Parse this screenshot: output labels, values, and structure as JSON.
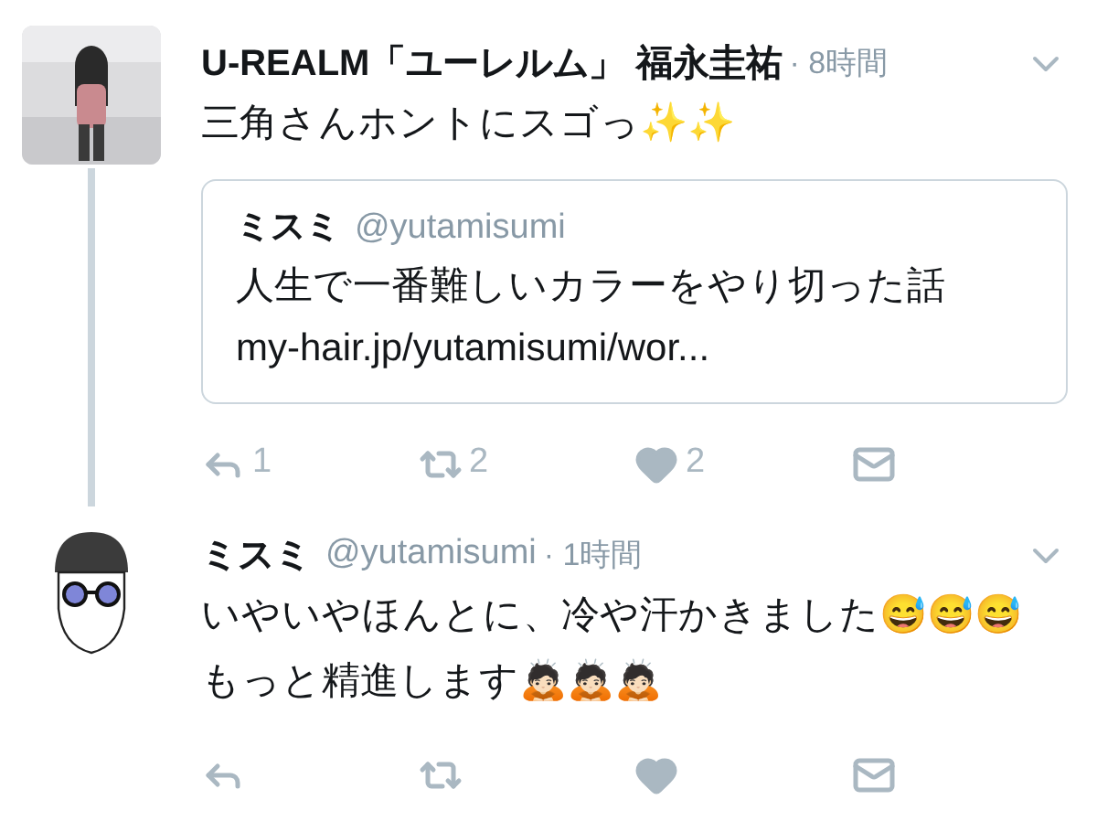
{
  "tweets": [
    {
      "name": "U-REALM「ユーレルム」 福永圭祐",
      "time": "· 8時間",
      "lines": [
        "三角さんホントにスゴっ✨✨"
      ],
      "quote": {
        "name": "ミスミ",
        "handle": "@yutamisumi",
        "lines": [
          "人生で一番難しいカラーをやり切った話",
          "my-hair.jp/yutamisumi/wor..."
        ]
      },
      "actions": {
        "replies": "1",
        "retweets": "2",
        "likes": "2"
      },
      "thread_line": true
    },
    {
      "name": "ミスミ",
      "handle": "@yutamisumi",
      "time": "· 1時間",
      "lines": [
        "いやいやほんとに、冷や汗かきました😅😅😅",
        "もっと精進します🙇🏻🙇🏻🙇🏻"
      ],
      "thread_line": false
    }
  ]
}
